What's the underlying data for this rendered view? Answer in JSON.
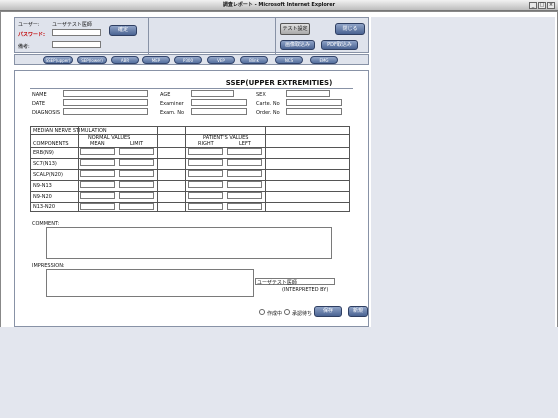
{
  "window": {
    "title": "調査レポート - Microsoft Internet Explorer"
  },
  "header": {
    "user_label": "ユーザー:",
    "user_value": "ユーザテスト医師",
    "password_label": "パスワード:",
    "remark_label": "備考:",
    "confirm_button": "確定",
    "test_setting_button": "テスト設定",
    "close_button": "閉じる",
    "image_import_button": "画像取込み",
    "pdf_import_button": "PDF取込み"
  },
  "tabs": [
    {
      "label": "SSEP(upper)"
    },
    {
      "label": "SEP(lower)"
    },
    {
      "label": "ABR"
    },
    {
      "label": "MEP"
    },
    {
      "label": "P300"
    },
    {
      "label": "VEP"
    },
    {
      "label": "Blink"
    },
    {
      "label": "NCS"
    },
    {
      "label": "EMG"
    }
  ],
  "form": {
    "title": "SSEP(UPPER EXTREMITIES)",
    "name_label": "NAME",
    "age_label": "AGE",
    "sex_label": "SEX",
    "date_label": "DATE",
    "examiner_label": "Examiner",
    "carte_label": "Carte. No",
    "diagnosis_label": "DIAGNOSIS",
    "exam_label": "Exam. No",
    "order_label": "Order. No",
    "table": {
      "caption": "MEDIAN NERVE STIMULATION",
      "normal_values": "NORMAL VALUES",
      "patients_values": "PATIENT'S VALUES",
      "components": "COMPONENTS",
      "mean": "MEAN",
      "limit": "LIMIT",
      "right": "RIGHT",
      "left": "LEFT",
      "rows": [
        "ERB(N9)",
        "SC7(N13)",
        "SCALP(N20)",
        "N9-N13",
        "N9-N20",
        "N13-N20"
      ]
    },
    "comment_label": "COMMENT:",
    "impression_label": "IMPRESSION:",
    "interpreted_value": "ユーザテスト医師",
    "interpreted_label": "(INTERPRETED BY)",
    "status_in_progress": "作成中",
    "status_approved": "承認待ち",
    "save_button": "保存",
    "new_button": "新規"
  }
}
